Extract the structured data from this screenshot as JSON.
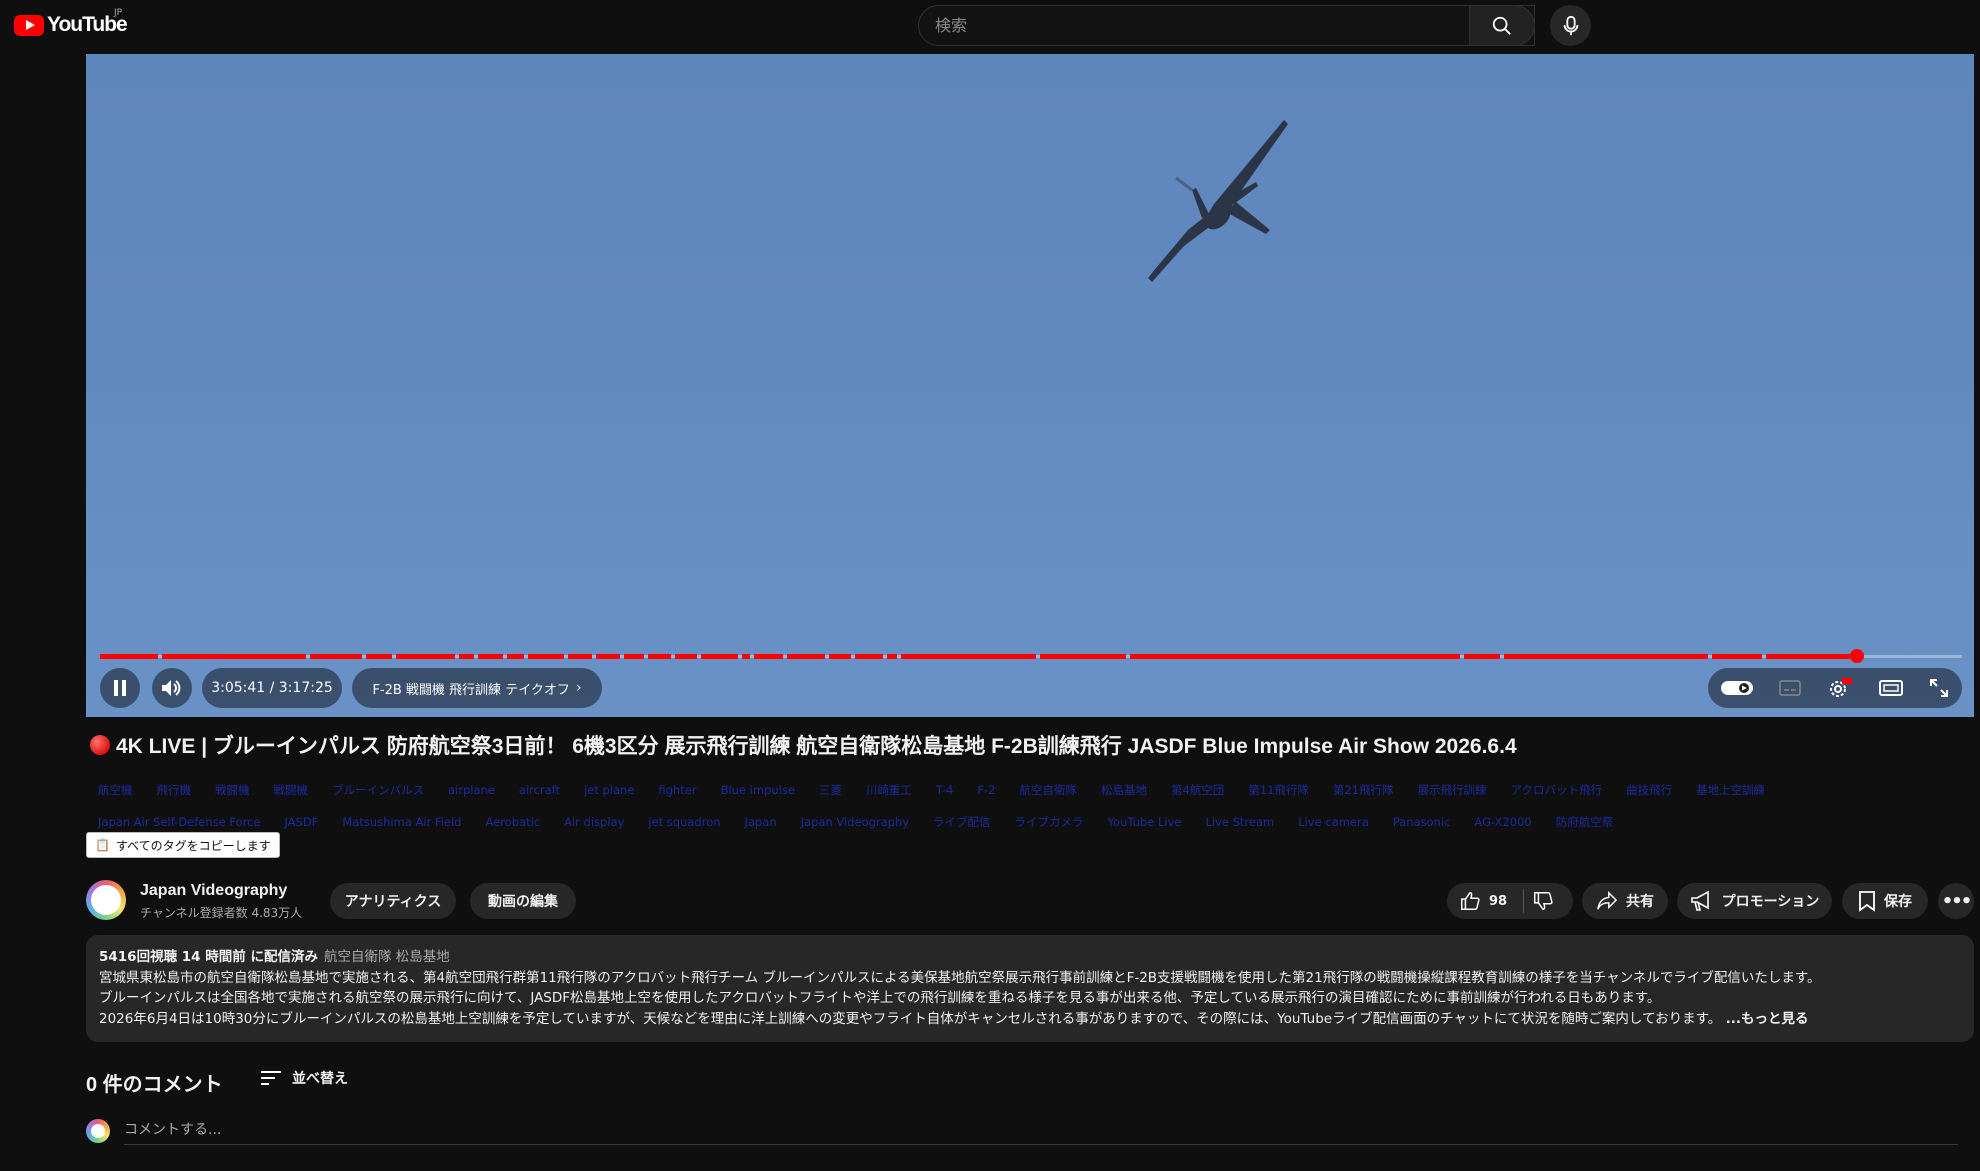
{
  "header": {
    "logo_text": "YouTube",
    "region": "JP",
    "search_placeholder": "検索"
  },
  "player": {
    "time": "3:05:41 / 3:17:25",
    "chapter": "F-2B 戦闘機 飛行訓練 テイクオフ",
    "progress_fraction": 0.94
  },
  "video": {
    "title": "4K LIVE | ブルーインパルス 防府航空祭3日前！ 6機3区分 展示飛行訓練 航空自衛隊松島基地 F-2B訓練飛行 JASDF Blue Impulse Air Show 2026.6.4",
    "tags_row1": [
      "航空機",
      "飛行機",
      "戦闘機",
      "戦闘機",
      "ブルーインパルス",
      "airplane",
      "aircraft",
      "jet plane",
      "fighter",
      "Blue impulse",
      "三菱",
      "川崎重工",
      "T-4",
      "F-2",
      "航空自衛隊",
      "松島基地",
      "第4航空団",
      "第11飛行隊",
      "第21飛行隊",
      "展示飛行訓練",
      "アクロバット飛行",
      "曲技飛行",
      "基地上空訓練"
    ],
    "tags_row2": [
      "Japan Air Self-Defense Force",
      "JASDF",
      "Matsushima Air Field",
      "Aerobatic",
      "Air display",
      "jet squadron",
      "Japan",
      "Japan Videography",
      "ライブ配信",
      "ライブカメラ",
      "YouTube Live",
      "Live Stream",
      "Live camera",
      "Panasonic",
      "AG-X2000",
      "防府航空祭"
    ],
    "copy_tags_label": "すべてのタグをコピーします"
  },
  "channel": {
    "name": "Japan Videography",
    "subscribers": "チャンネル登録者数 4.83万人",
    "analytics_label": "アナリティクス",
    "edit_label": "動画の編集"
  },
  "actions": {
    "likes": "98",
    "share": "共有",
    "promote": "プロモーション",
    "save": "保存"
  },
  "description": {
    "meta": "5416回視聴  14 時間前 に配信済み",
    "hashtags": "航空自衛隊 松島基地",
    "line1": "宮城県東松島市の航空自衛隊松島基地で実施される、第4航空団飛行群第11飛行隊のアクロバット飛行チーム ブルーインパルスによる美保基地航空祭展示飛行事前訓練とF-2B支援戦闘機を使用した第21飛行隊の戦闘機操縦課程教育訓練の様子を当チャンネルでライブ配信いたします。",
    "line2": "ブルーインパルスは全国各地で実施される航空祭の展示飛行に向けて、JASDF松島基地上空を使用したアクロバットフライトや洋上での飛行訓練を重ねる様子を見る事が出来る他、予定している展示飛行の演目確認にために事前訓練が行われる日もあります。",
    "line3": "2026年6月4日は10時30分にブルーインパルスの松島基地上空訓練を予定していますが、天候などを理由に洋上訓練への変更やフライト自体がキャンセルされる事がありますので、その際には、YouTubeライブ配信画面のチャットにて状況を随時ご案内しております。",
    "more": "...もっと見る"
  },
  "comments": {
    "count": "0 件のコメント",
    "sort_label": "並べ替え",
    "placeholder": "コメントする..."
  },
  "colors": {
    "accent": "#ff0000",
    "background": "#0f0f0f",
    "sky": "#6289bf"
  }
}
